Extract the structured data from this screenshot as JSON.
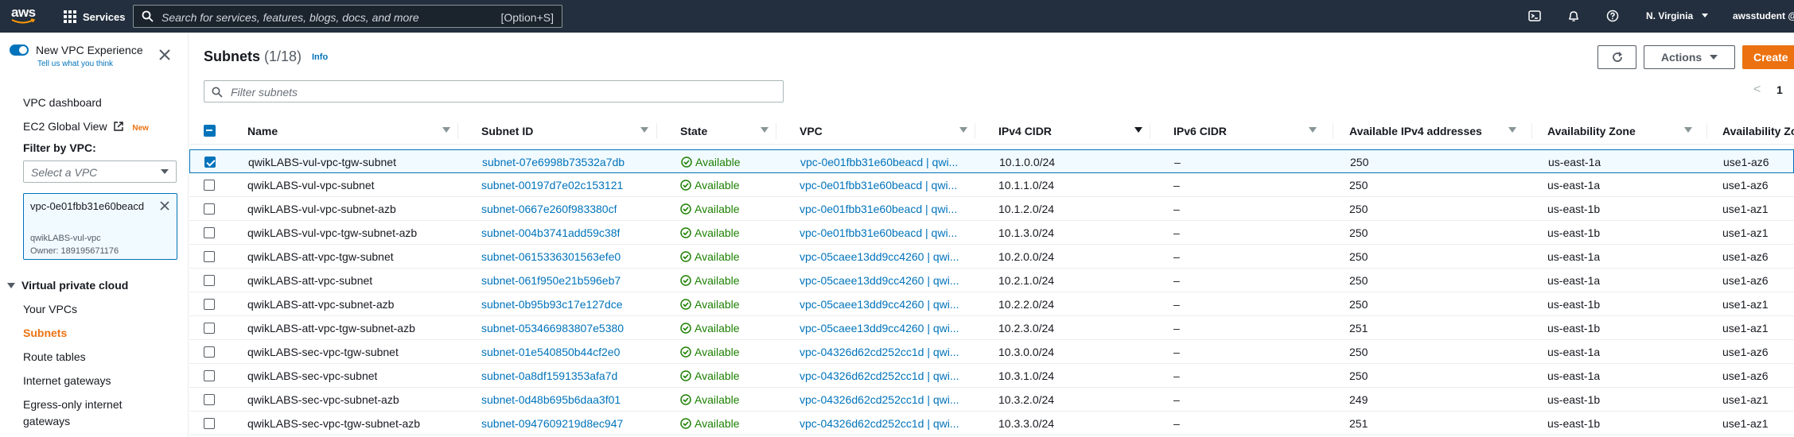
{
  "topnav": {
    "logo_text": "aws",
    "services_label": "Services",
    "search_placeholder": "Search for services, features, blogs, docs, and more",
    "search_shortcut": "[Option+S]",
    "region": "N. Virginia",
    "account": "awsstudent @"
  },
  "sidebar": {
    "new_vpc_label": "New VPC Experience",
    "tell_us": "Tell us what you think",
    "vpc_dashboard": "VPC dashboard",
    "ec2_global_view": "EC2 Global View",
    "new_badge": "New",
    "filter_label": "Filter by VPC:",
    "select_placeholder": "Select a VPC",
    "token": {
      "vpc_id": "vpc-0e01fbb31e60beacd",
      "vpc_name": "qwikLABS-vul-vpc",
      "owner": "Owner: 189195671176"
    },
    "section_title": "Virtual private cloud",
    "items": [
      "Your VPCs",
      "Subnets",
      "Route tables",
      "Internet gateways",
      "Egress-only internet",
      "gateways"
    ]
  },
  "main": {
    "title": "Subnets",
    "count": "(1/18)",
    "info": "Info",
    "actions_label": "Actions",
    "create_label": "Create",
    "filter_placeholder": "Filter subnets",
    "page_prev": "<",
    "page_num": "1"
  },
  "table": {
    "columns": [
      "Name",
      "Subnet ID",
      "State",
      "VPC",
      "IPv4 CIDR",
      "IPv6 CIDR",
      "Available IPv4 addresses",
      "Availability Zone",
      "Availability Zo"
    ],
    "rows": [
      {
        "name": "qwikLABS-vul-vpc-tgw-subnet",
        "subnet_id": "subnet-07e6998b73532a7db",
        "state": "Available",
        "vpc": "vpc-0e01fbb31e60beacd | qwi...",
        "ipv4": "10.1.0.0/24",
        "ipv6": "–",
        "avail": "250",
        "az": "us-east-1a",
        "azid": "use1-az6",
        "selected": true
      },
      {
        "name": "qwikLABS-vul-vpc-subnet",
        "subnet_id": "subnet-00197d7e02c153121",
        "state": "Available",
        "vpc": "vpc-0e01fbb31e60beacd | qwi...",
        "ipv4": "10.1.1.0/24",
        "ipv6": "–",
        "avail": "250",
        "az": "us-east-1a",
        "azid": "use1-az6"
      },
      {
        "name": "qwikLABS-vul-vpc-subnet-azb",
        "subnet_id": "subnet-0667e260f983380cf",
        "state": "Available",
        "vpc": "vpc-0e01fbb31e60beacd | qwi...",
        "ipv4": "10.1.2.0/24",
        "ipv6": "–",
        "avail": "250",
        "az": "us-east-1b",
        "azid": "use1-az1"
      },
      {
        "name": "qwikLABS-vul-vpc-tgw-subnet-azb",
        "subnet_id": "subnet-004b3741add59c38f",
        "state": "Available",
        "vpc": "vpc-0e01fbb31e60beacd | qwi...",
        "ipv4": "10.1.3.0/24",
        "ipv6": "–",
        "avail": "250",
        "az": "us-east-1b",
        "azid": "use1-az1"
      },
      {
        "name": "qwikLABS-att-vpc-tgw-subnet",
        "subnet_id": "subnet-0615336301563efe0",
        "state": "Available",
        "vpc": "vpc-05caee13dd9cc4260 | qwi...",
        "ipv4": "10.2.0.0/24",
        "ipv6": "–",
        "avail": "250",
        "az": "us-east-1a",
        "azid": "use1-az6"
      },
      {
        "name": "qwikLABS-att-vpc-subnet",
        "subnet_id": "subnet-061f950e21b596eb7",
        "state": "Available",
        "vpc": "vpc-05caee13dd9cc4260 | qwi...",
        "ipv4": "10.2.1.0/24",
        "ipv6": "–",
        "avail": "250",
        "az": "us-east-1a",
        "azid": "use1-az6"
      },
      {
        "name": "qwikLABS-att-vpc-subnet-azb",
        "subnet_id": "subnet-0b95b93c17e127dce",
        "state": "Available",
        "vpc": "vpc-05caee13dd9cc4260 | qwi...",
        "ipv4": "10.2.2.0/24",
        "ipv6": "–",
        "avail": "250",
        "az": "us-east-1b",
        "azid": "use1-az1"
      },
      {
        "name": "qwikLABS-att-vpc-tgw-subnet-azb",
        "subnet_id": "subnet-053466983807e5380",
        "state": "Available",
        "vpc": "vpc-05caee13dd9cc4260 | qwi...",
        "ipv4": "10.2.3.0/24",
        "ipv6": "–",
        "avail": "251",
        "az": "us-east-1b",
        "azid": "use1-az1"
      },
      {
        "name": "qwikLABS-sec-vpc-tgw-subnet",
        "subnet_id": "subnet-01e540850b44cf2e0",
        "state": "Available",
        "vpc": "vpc-04326d62cd252cc1d | qwi...",
        "ipv4": "10.3.0.0/24",
        "ipv6": "–",
        "avail": "250",
        "az": "us-east-1a",
        "azid": "use1-az6"
      },
      {
        "name": "qwikLABS-sec-vpc-subnet",
        "subnet_id": "subnet-0a8df1591353afa7d",
        "state": "Available",
        "vpc": "vpc-04326d62cd252cc1d | qwi...",
        "ipv4": "10.3.1.0/24",
        "ipv6": "–",
        "avail": "250",
        "az": "us-east-1a",
        "azid": "use1-az6"
      },
      {
        "name": "qwikLABS-sec-vpc-subnet-azb",
        "subnet_id": "subnet-0d48b695b6daa3f01",
        "state": "Available",
        "vpc": "vpc-04326d62cd252cc1d | qwi...",
        "ipv4": "10.3.2.0/24",
        "ipv6": "–",
        "avail": "249",
        "az": "us-east-1b",
        "azid": "use1-az1"
      },
      {
        "name": "qwikLABS-sec-vpc-tgw-subnet-azb",
        "subnet_id": "subnet-0947609219d8ec947",
        "state": "Available",
        "vpc": "vpc-04326d62cd252cc1d | qwi...",
        "ipv4": "10.3.3.0/24",
        "ipv6": "–",
        "avail": "251",
        "az": "us-east-1b",
        "azid": "use1-az1"
      }
    ]
  },
  "colors": {
    "nav_bg": "#232f3e",
    "link": "#0073bb",
    "accent_orange": "#ec7211",
    "status_green": "#1d8102"
  }
}
